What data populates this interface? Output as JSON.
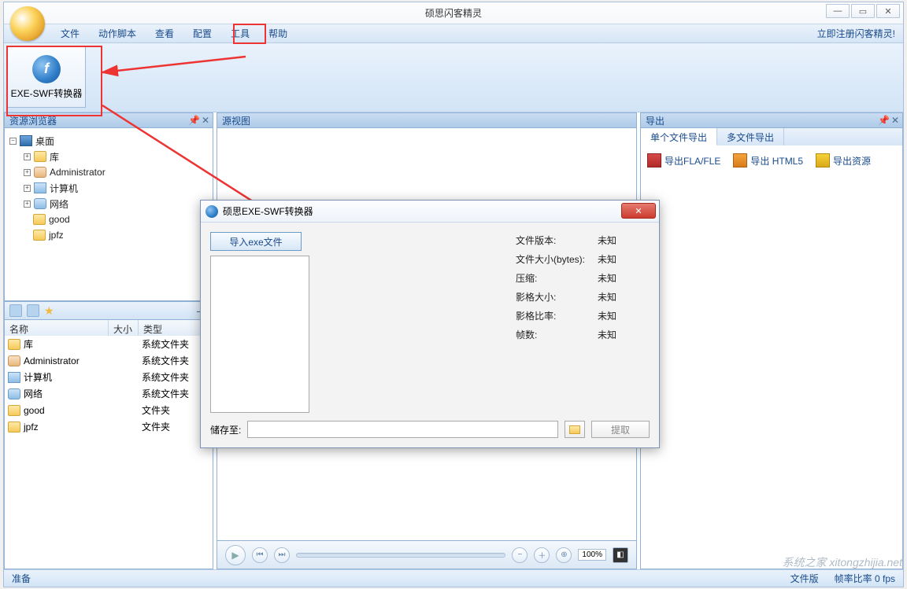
{
  "title": "硕思闪客精灵",
  "menubar": {
    "items": [
      "文件",
      "动作脚本",
      "查看",
      "配置",
      "工具",
      "帮助"
    ],
    "right": "立即注册闪客精灵!"
  },
  "toolbar": {
    "exe_swf_label": "EXE-SWF转换器"
  },
  "panels": {
    "resource_browser": "资源浏览器",
    "source_view": "源视图",
    "export": "导出"
  },
  "tree": {
    "root": "桌面",
    "items": [
      "库",
      "Administrator",
      "计算机",
      "网络",
      "good",
      "jpfz"
    ]
  },
  "list": {
    "headers": {
      "name": "名称",
      "size": "大小",
      "type": "类型"
    },
    "rows": [
      {
        "name": "库",
        "type": "系统文件夹"
      },
      {
        "name": "Administrator",
        "type": "系统文件夹"
      },
      {
        "name": "计算机",
        "type": "系统文件夹"
      },
      {
        "name": "网络",
        "type": "系统文件夹"
      },
      {
        "name": "good",
        "type": "文件夹"
      },
      {
        "name": "jpfz",
        "type": "文件夹"
      }
    ]
  },
  "export": {
    "tabs": [
      "单个文件导出",
      "多文件导出"
    ],
    "options": {
      "fla": "导出FLA/FLE",
      "html5": "导出 HTML5",
      "res": "导出资源"
    }
  },
  "player": {
    "zoom": "100%"
  },
  "status": {
    "ready": "准备",
    "file_version": "文件版",
    "frame_rate": "帧率比率 0 fps"
  },
  "dialog": {
    "title": "硕思EXE-SWF转换器",
    "import_btn": "导入exe文件",
    "info": {
      "labels": {
        "version": "文件版本:",
        "size": "文件大小(bytes):",
        "compress": "压缩:",
        "movie_size": "影格大小:",
        "movie_rate": "影格比率:",
        "frames": "帧数:"
      },
      "unknown": "未知"
    },
    "save_label": "储存至:",
    "extract": "提取"
  },
  "watermark": "系统之家 xitongzhijia.net"
}
